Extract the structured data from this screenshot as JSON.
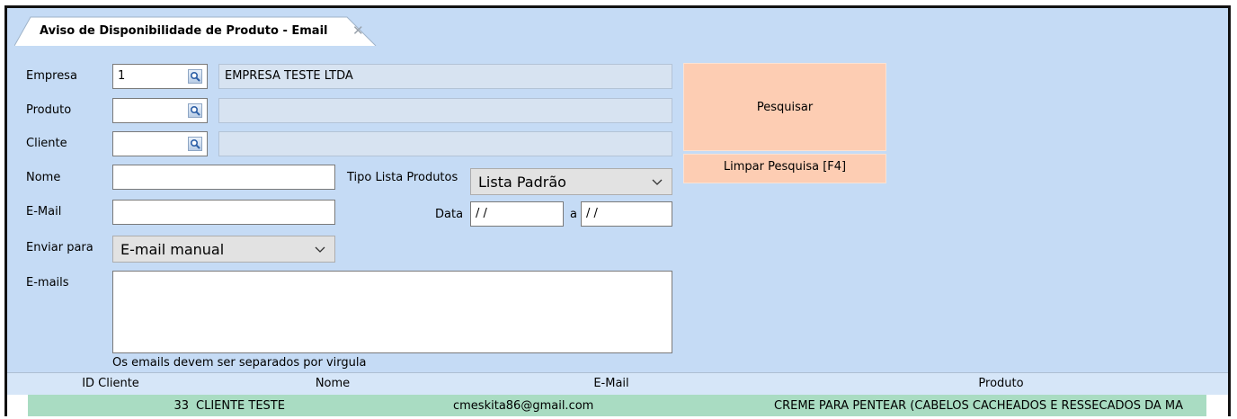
{
  "tab": {
    "title": "Aviso de Disponibilidade de Produto - Email",
    "close_glyph": "✕"
  },
  "form": {
    "empresa_label": "Empresa",
    "empresa_code": "1",
    "empresa_name": "EMPRESA TESTE LTDA",
    "produto_label": "Produto",
    "produto_code": "",
    "produto_name": "",
    "cliente_label": "Cliente",
    "cliente_code": "",
    "cliente_name": "",
    "nome_label": "Nome",
    "nome_value": "",
    "email_label": "E-Mail",
    "email_value": "",
    "enviar_label": "Enviar para",
    "enviar_value": "E-mail manual",
    "emails_label": "E-mails",
    "emails_value": "",
    "emails_hint": "Os emails devem ser separados por virgula",
    "tipo_lista_label": "Tipo Lista Produtos",
    "tipo_lista_value": "Lista Padrão",
    "data_label": "Data",
    "data_from": "/ /",
    "data_sep": "a",
    "data_to": "/ /"
  },
  "buttons": {
    "search": "Pesquisar",
    "clear": "Limpar Pesquisa [F4]"
  },
  "grid": {
    "columns": [
      "ID Cliente",
      "Nome",
      "E-Mail",
      "Produto"
    ],
    "rows": [
      {
        "id": "33",
        "nome": "CLIENTE TESTE",
        "email": "cmeskita86@gmail.com",
        "produto": "CREME PARA PENTEAR (CABELOS CACHEADOS E RESSECADOS DA MA"
      }
    ]
  },
  "colors": {
    "background": "#c5dbf5",
    "button": "#fdcdb3",
    "row_highlight": "#a9dcc2",
    "grid_header": "#d6e6f8"
  },
  "icons": {
    "lookup": "magnifier-icon",
    "dropdown": "chevron-down-icon",
    "tab_close": "close-icon"
  }
}
